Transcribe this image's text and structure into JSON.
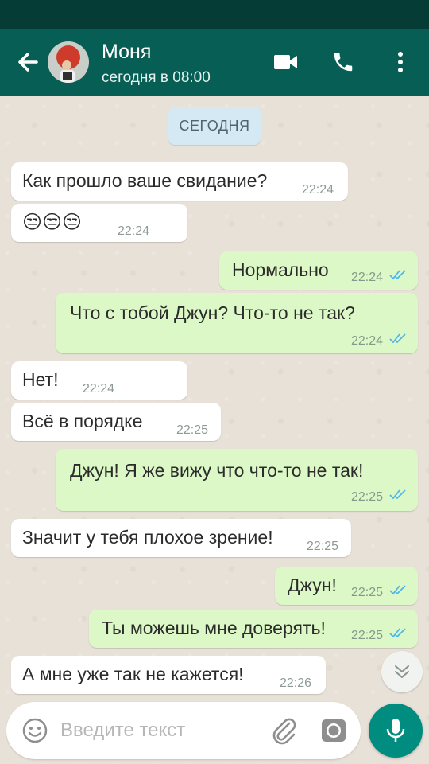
{
  "header": {
    "contact_name": "Моня",
    "last_seen": "сегодня в 08:00",
    "icons": [
      "back-arrow-icon",
      "videocam-icon",
      "phone-icon",
      "more-vert-icon"
    ],
    "bar_color": "#075e54",
    "status_bar_color": "#053c35"
  },
  "chat": {
    "date_chip": "СЕГОДНЯ",
    "incoming_color": "#ffffff",
    "outgoing_color": "#dcf8c6",
    "messages": [
      {
        "dir": "in",
        "text": "Как прошло ваше свидание?",
        "time": "22:24"
      },
      {
        "dir": "in",
        "text": "😒😒😒",
        "time": "22:24"
      },
      {
        "dir": "out",
        "text": "Нормально",
        "time": "22:24",
        "read": true
      },
      {
        "dir": "out",
        "text": "Что с тобой Джун? Что-то не так?",
        "time": "22:24",
        "read": true
      },
      {
        "dir": "in",
        "text": "Нет!",
        "time": "22:24"
      },
      {
        "dir": "in",
        "text": "Всё в порядке",
        "time": "22:25"
      },
      {
        "dir": "out",
        "text": "Джун! Я же вижу что что-то не так!",
        "time": "22:25",
        "read": true
      },
      {
        "dir": "in",
        "text": "Значит у тебя плохое зрение!",
        "time": "22:25"
      },
      {
        "dir": "out",
        "text": "Джун!",
        "time": "22:25",
        "read": true
      },
      {
        "dir": "out",
        "text": "Ты можешь мне доверять!",
        "time": "22:25",
        "read": true
      },
      {
        "dir": "in",
        "text": "А мне уже так не кажется!",
        "time": "22:26"
      }
    ]
  },
  "composer": {
    "placeholder": "Введите текст",
    "icons": [
      "emoji-icon",
      "paperclip-icon",
      "camera-icon",
      "mic-icon"
    ],
    "accent": "#008c7e"
  }
}
